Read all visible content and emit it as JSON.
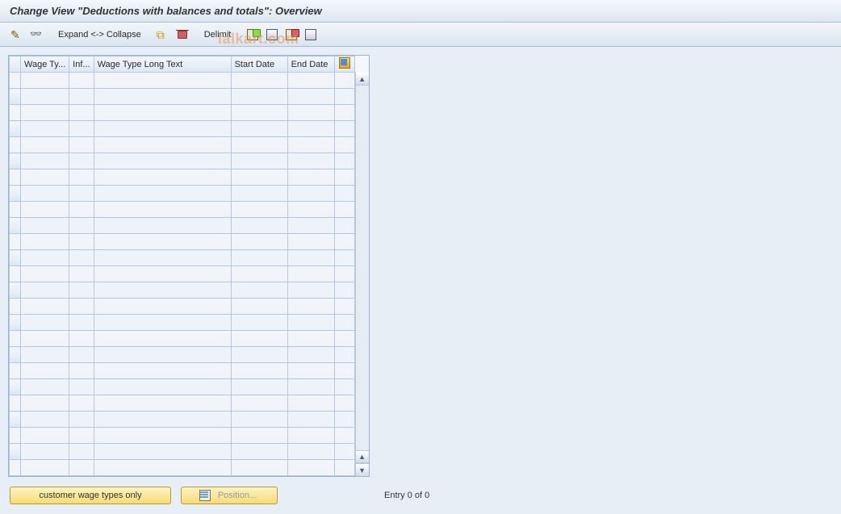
{
  "title": "Change View \"Deductions with balances and totals\": Overview",
  "toolbar": {
    "expand_collapse_label": "Expand <-> Collapse",
    "delimit_label": "Delimit"
  },
  "table": {
    "columns": [
      "Wage Ty...",
      "Inf...",
      "Wage Type Long Text",
      "Start Date",
      "End Date"
    ],
    "row_count": 25
  },
  "footer": {
    "customer_button_label": "customer wage types only",
    "position_button_label": "Position...",
    "entry_status": "Entry 0 of 0"
  },
  "watermark": "ialkart.com"
}
